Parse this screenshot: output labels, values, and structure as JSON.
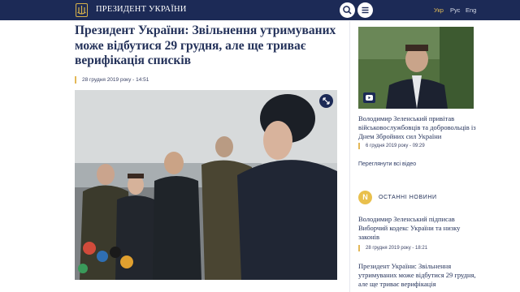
{
  "header": {
    "site_title": "ПРЕЗИДЕНТ УКРАЇНИ",
    "languages": [
      {
        "label": "Укр",
        "active": true
      },
      {
        "label": "Рус",
        "active": false
      },
      {
        "label": "Eng",
        "active": false
      }
    ],
    "icons": {
      "emblem": "trident-emblem",
      "search": "search-icon",
      "menu": "menu-icon"
    }
  },
  "article": {
    "headline": "Президент України: Звільнення утримуваних може відбутися 29 грудня, але ще триває верифікація списків",
    "date": "28 грудня 2019 року - 14:51",
    "lead": "",
    "icons": {
      "expand": "expand-icon"
    }
  },
  "sidebar": {
    "video": {
      "title": "Володимир Зеленський привітав військовослужбовців та добровольців із Днем Збройних сил України",
      "date": "6 грудня 2019 року - 09:29",
      "icon": "video-icon"
    },
    "watch_all_label": "Переглянути всі відео",
    "news_badge": "N",
    "news_heading": "ОСТАННІ НОВИНИ",
    "news": [
      {
        "title": "Володимир Зеленський підписав Виборчий кодекс України та низку законів",
        "date": "28 грудня 2019 року - 18:21"
      },
      {
        "title": "Президент України: Звільнення утримуваних може відбутися 29 грудня, але ще триває верифікація",
        "date": ""
      }
    ]
  },
  "colors": {
    "navy": "#1c2a56",
    "gold": "#e3b857",
    "text": "#24325a"
  }
}
